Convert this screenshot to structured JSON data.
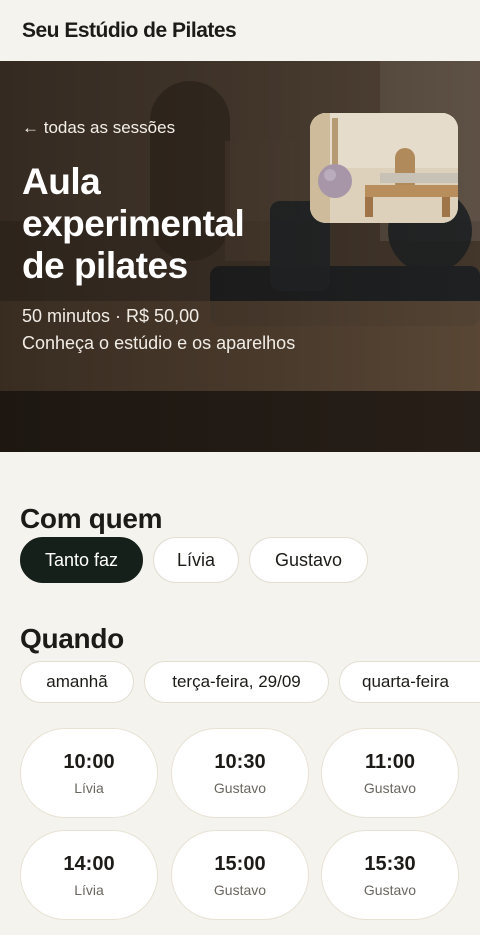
{
  "header": {
    "brand": "Seu Estúdio de Pilates"
  },
  "hero": {
    "back_link": "← todas as sessões",
    "title": "Aula experimental de pilates",
    "meta": "50 minutos · R$ 50,00",
    "description": "Conheça o estúdio e os aparelhos"
  },
  "who": {
    "title": "Com quem",
    "options": [
      "Tanto faz",
      "Lívia",
      "Gustavo"
    ],
    "selected": "Tanto faz"
  },
  "when": {
    "title": "Quando",
    "days": [
      "amanhã",
      "terça-feira, 29/09",
      "quarta-feira"
    ],
    "slots": [
      {
        "time": "10:00",
        "instructor": "Lívia"
      },
      {
        "time": "10:30",
        "instructor": "Gustavo"
      },
      {
        "time": "11:00",
        "instructor": "Gustavo"
      },
      {
        "time": "14:00",
        "instructor": "Lívia"
      },
      {
        "time": "15:00",
        "instructor": "Gustavo"
      },
      {
        "time": "15:30",
        "instructor": "Gustavo"
      }
    ]
  },
  "colors": {
    "background": "#f4f3ee",
    "selected_chip": "#16201b",
    "text": "#1c1b17"
  }
}
